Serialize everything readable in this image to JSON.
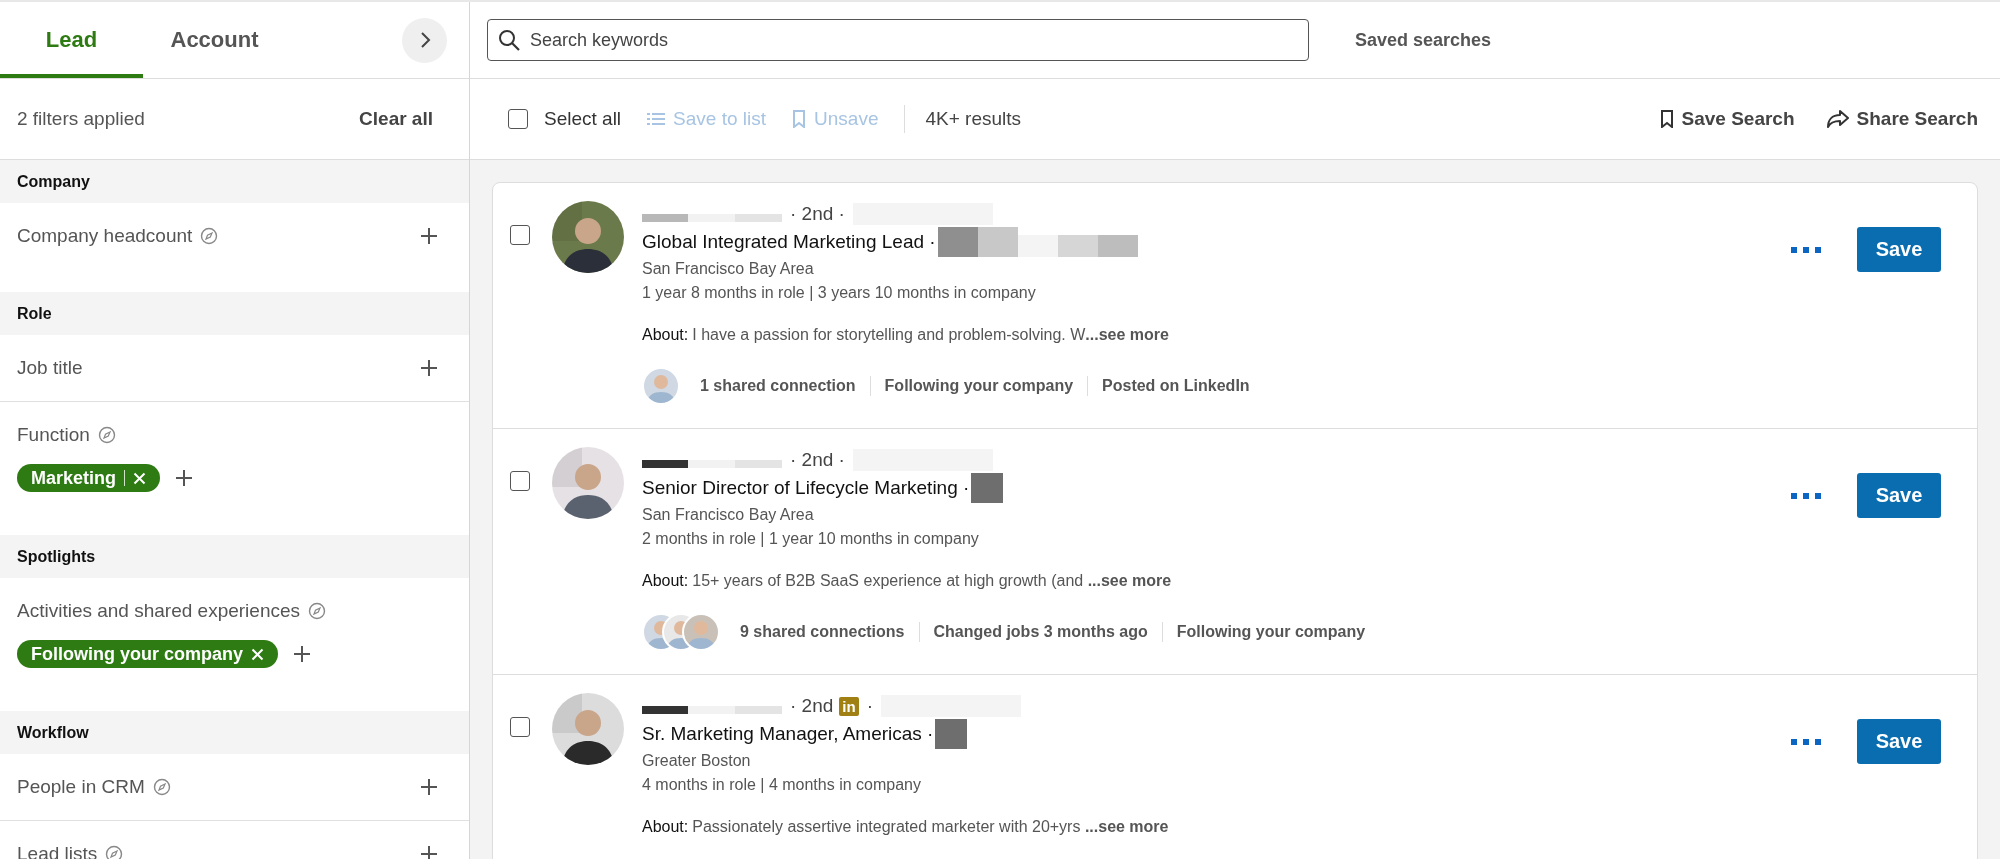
{
  "filter_tabs": [
    {
      "label": "Lead",
      "selected": true
    },
    {
      "label": "Account",
      "selected": false
    }
  ],
  "filters_summary": {
    "text": "2 filters applied",
    "clear": "Clear all"
  },
  "filter_sections": [
    {
      "heading": "Company",
      "filters": [
        {
          "label": "Company headcount",
          "info": true
        }
      ]
    },
    {
      "heading": "Role",
      "filters": [
        {
          "label": "Job title",
          "info": false
        },
        {
          "label": "Function",
          "info": true,
          "chips": [
            {
              "label": "Marketing",
              "divider": true
            }
          ]
        }
      ]
    },
    {
      "heading": "Spotlights",
      "filters": [
        {
          "label": "Activities and shared experiences",
          "info": true,
          "chips": [
            {
              "label": "Following your company",
              "divider": false
            }
          ]
        }
      ]
    },
    {
      "heading": "Workflow",
      "filters": [
        {
          "label": "People in CRM",
          "info": true
        },
        {
          "label": "Lead lists",
          "info": true
        }
      ]
    }
  ],
  "search": {
    "placeholder": "Search keywords"
  },
  "saved_searches": "Saved searches",
  "toolbar": {
    "select_all": {
      "label": "Select all",
      "checked": false
    },
    "actions": [
      {
        "label": "Save to list",
        "disabled": true
      },
      {
        "label": "Unsave",
        "disabled": true
      }
    ],
    "results": "4K+ results",
    "right_actions": [
      {
        "label": "Save Search"
      },
      {
        "label": "Share Search"
      }
    ]
  },
  "results": [
    {
      "checked": false,
      "degree": "· 2nd ·",
      "title": "Global Integrated Marketing Lead ·",
      "location": "San Francisco Bay Area",
      "tenure": "1 year 8 months in role | 3 years 10 months in company",
      "about_label": "About:",
      "about": "I have a passion for storytelling and problem-solving. W",
      "see_more": "...see more",
      "connection_photos": [
        {
          "kind": "picture"
        }
      ],
      "insights": [
        "1 shared connection",
        "Following your company",
        "Posted on LinkedIn"
      ],
      "save": "Save"
    },
    {
      "checked": false,
      "degree": "· 2nd ·",
      "title": "Senior Director of Lifecycle Marketing ·",
      "location": "San Francisco Bay Area",
      "tenure": "2 months in role | 1 year 10 months in company",
      "about_label": "About:",
      "about": "15+ years of B2B SaaS experience at high growth (and ",
      "see_more": "...see more",
      "connection_photos": [
        {
          "kind": "picture"
        },
        {
          "kind": "picture"
        },
        {
          "kind": "picture"
        }
      ],
      "insights": [
        "9 shared connections",
        "Changed jobs 3 months ago",
        "Following your company"
      ],
      "save": "Save"
    },
    {
      "checked": false,
      "degree": "· 2nd",
      "badge": "in",
      "degree_after": "·",
      "title": "Sr. Marketing Manager, Americas ·",
      "location": "Greater Boston",
      "tenure": "4 months in role | 4 months in company",
      "about_label": "About:",
      "about": "Passionately assertive integrated marketer with 20+yrs ",
      "see_more": "...see more",
      "save": "Save"
    }
  ]
}
